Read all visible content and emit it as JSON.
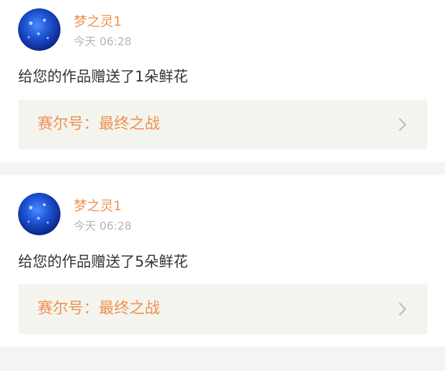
{
  "notifications": [
    {
      "avatar_icon": "starry-sky-avatar",
      "username": "梦之灵1",
      "timestamp": "今天 06:28",
      "message": "给您的作品赠送了1朵鲜花",
      "work_title": "赛尔号：最终之战",
      "chevron_icon": "chevron-right-icon"
    },
    {
      "avatar_icon": "starry-sky-avatar",
      "username": "梦之灵1",
      "timestamp": "今天 06:28",
      "message": "给您的作品赠送了5朵鲜花",
      "work_title": "赛尔号：最终之战",
      "chevron_icon": "chevron-right-icon"
    }
  ],
  "colors": {
    "accent": "#f0904f",
    "timestamp": "#b5b5b5",
    "text": "#333333",
    "link_bg": "#f4f4ef",
    "page_bg": "#f4f4f4"
  }
}
